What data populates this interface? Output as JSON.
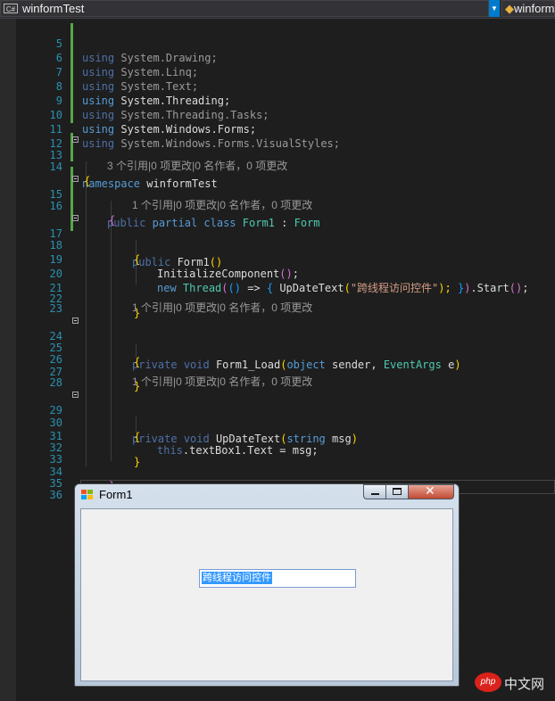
{
  "navbar": {
    "lang_badge": "C#",
    "project": "winformTest",
    "right_project": "winform"
  },
  "code": {
    "l5": [
      "using",
      " System.Drawing;"
    ],
    "l6": [
      "using",
      " System.Linq;"
    ],
    "l7": [
      "using",
      " System.Text;"
    ],
    "l8": [
      "using",
      " System.Threading;"
    ],
    "l9": [
      "using",
      " System.Threading.Tasks;"
    ],
    "l10": [
      "using",
      " System.Windows.Forms;"
    ],
    "l11": [
      "using",
      " System.Windows.Forms.VisualStyles;"
    ],
    "l13": [
      "namespace",
      " winformTest"
    ],
    "brace_open": "{",
    "brace_close": "}",
    "codelens_class": "3 个引用|0 项更改|0 名作者，0 项更改",
    "l15": [
      "public",
      "partial",
      "class",
      "Form1",
      ":",
      "Form"
    ],
    "codelens_ctor": "1 个引用|0 项更改|0 名作者，0 项更改",
    "l17": [
      "public",
      " Form1",
      "()"
    ],
    "l19": [
      "InitializeComponent",
      "()",
      ";"
    ],
    "l20": [
      "new",
      "Thread",
      "(",
      "()",
      " => ",
      "{",
      " UpDateText",
      "(",
      "\"跨线程访问控件\"",
      ");",
      " }",
      ")",
      ".Start",
      "()",
      ";"
    ],
    "codelens_load": "1 个引用|0 项更改|0 名作者，0 项更改",
    "l24": [
      "private",
      "void",
      " Form1_Load",
      "(",
      "object",
      " sender, ",
      "EventArgs",
      " e",
      ")"
    ],
    "codelens_update": "1 个引用|0 项更改|0 名作者，0 项更改",
    "l29": [
      "private",
      "void",
      " UpDateText",
      "(",
      "string",
      " msg",
      ")"
    ],
    "l31": [
      "this",
      ".textBox1.Text = msg;"
    ]
  },
  "line_numbers": [
    "5",
    "6",
    "7",
    "8",
    "9",
    "10",
    "11",
    "12",
    "13",
    "14",
    "15",
    "16",
    "17",
    "18",
    "19",
    "20",
    "21",
    "22",
    "23",
    "24",
    "25",
    "26",
    "27",
    "28",
    "29",
    "30",
    "31",
    "32",
    "33",
    "34",
    "35",
    "36"
  ],
  "form": {
    "title": "Form1",
    "textbox_value": "跨线程访问控件"
  },
  "watermark": {
    "logo": "php",
    "text": "中文网"
  },
  "colors": {
    "keyword": "#569cd6",
    "type": "#4ec9b0",
    "string": "#d69d85",
    "line_number": "#2b91af",
    "selection": "#3399ff"
  }
}
